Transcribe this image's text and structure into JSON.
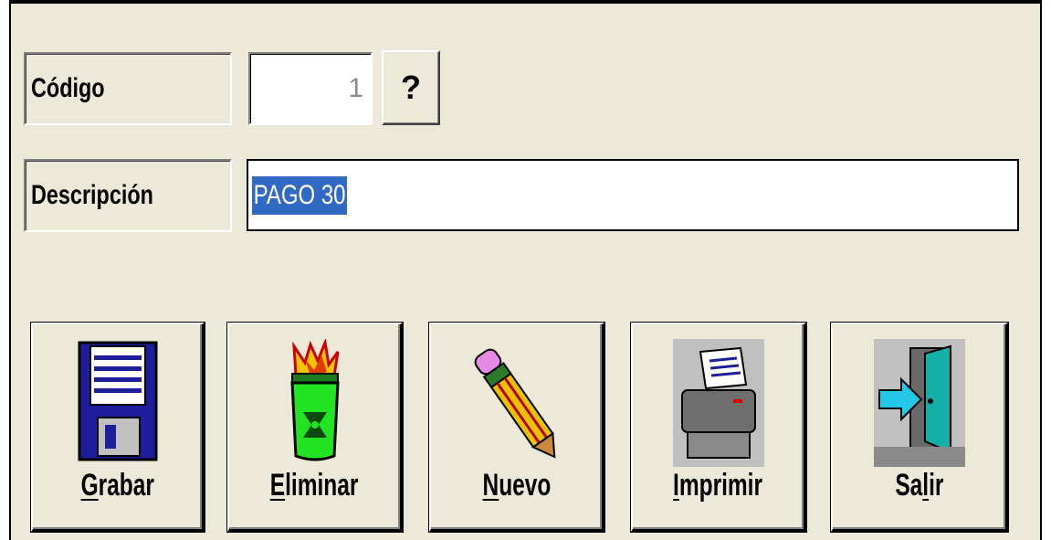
{
  "form": {
    "code_label": "Código",
    "code_value": "1",
    "help_label": "?",
    "description_label": "Descripción",
    "description_value": "PAGO 30"
  },
  "toolbar": {
    "buttons": [
      {
        "name": "save",
        "accel": "G",
        "rest": "rabar",
        "icon": "floppy-disk-icon"
      },
      {
        "name": "delete",
        "accel": "E",
        "rest": "liminar",
        "icon": "burning-trash-can-icon"
      },
      {
        "name": "new",
        "accel": "N",
        "rest": "uevo",
        "icon": "pencil-icon"
      },
      {
        "name": "print",
        "accel": "I",
        "rest": "mprimir",
        "icon": "printer-icon"
      },
      {
        "name": "exit",
        "accel": "Sa",
        "accel2": "l",
        "rest": "ir",
        "icon": "exit-door-icon"
      }
    ]
  },
  "colors": {
    "background": "#ece9d8",
    "selection": "#316ac5"
  }
}
